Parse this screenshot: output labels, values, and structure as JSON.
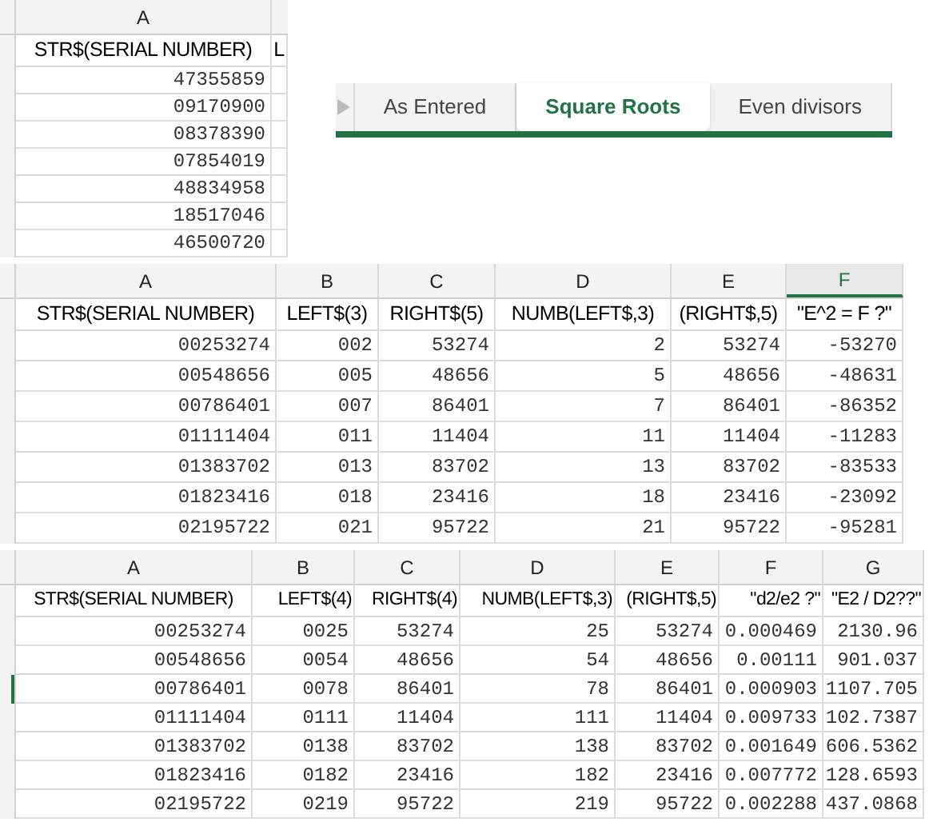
{
  "sheets": [
    {
      "columns": [
        {
          "letter": "A",
          "selected": false
        }
      ],
      "header": [
        "STR$(SERIAL NUMBER)",
        "L"
      ],
      "rows": [
        {
          "cells": [
            "47355859"
          ],
          "selected": false
        },
        {
          "cells": [
            "09170900"
          ],
          "selected": false
        },
        {
          "cells": [
            "08378390"
          ],
          "selected": false
        },
        {
          "cells": [
            "07854019"
          ],
          "selected": false
        },
        {
          "cells": [
            "48834958"
          ],
          "selected": false
        },
        {
          "cells": [
            "18517046"
          ],
          "selected": false
        },
        {
          "cells": [
            "46500720"
          ],
          "selected": false
        }
      ]
    },
    {
      "columns": [
        {
          "letter": "A",
          "selected": false
        },
        {
          "letter": "B",
          "selected": false
        },
        {
          "letter": "C",
          "selected": false
        },
        {
          "letter": "D",
          "selected": false
        },
        {
          "letter": "E",
          "selected": false
        },
        {
          "letter": "F",
          "selected": true
        }
      ],
      "header": [
        "STR$(SERIAL NUMBER)",
        "LEFT$(3)",
        "RIGHT$(5)",
        "NUMB(LEFT$,3)",
        "(RIGHT$,5)",
        "\"E^2 = F ?\""
      ],
      "rows": [
        {
          "cells": [
            "00253274",
            "002",
            "53274",
            "2",
            "53274",
            "-53270"
          ],
          "selected": false
        },
        {
          "cells": [
            "00548656",
            "005",
            "48656",
            "5",
            "48656",
            "-48631"
          ],
          "selected": false
        },
        {
          "cells": [
            "00786401",
            "007",
            "86401",
            "7",
            "86401",
            "-86352"
          ],
          "selected": false
        },
        {
          "cells": [
            "01111404",
            "011",
            "11404",
            "11",
            "11404",
            "-11283"
          ],
          "selected": false
        },
        {
          "cells": [
            "01383702",
            "013",
            "83702",
            "13",
            "83702",
            "-83533"
          ],
          "selected": false
        },
        {
          "cells": [
            "01823416",
            "018",
            "23416",
            "18",
            "23416",
            "-23092"
          ],
          "selected": false
        },
        {
          "cells": [
            "02195722",
            "021",
            "95722",
            "21",
            "95722",
            "-95281"
          ],
          "selected": false
        }
      ]
    },
    {
      "columns": [
        {
          "letter": "A",
          "selected": false
        },
        {
          "letter": "B",
          "selected": false
        },
        {
          "letter": "C",
          "selected": false
        },
        {
          "letter": "D",
          "selected": false
        },
        {
          "letter": "E",
          "selected": false
        },
        {
          "letter": "F",
          "selected": false
        },
        {
          "letter": "G",
          "selected": false
        }
      ],
      "header": [
        "STR$(SERIAL NUMBER)",
        "LEFT$(4)",
        "RIGHT$(4)",
        "NUMB(LEFT$,3)",
        "(RIGHT$,5)",
        "\"d2/e2 ?\"",
        "\"E2 / D2??\""
      ],
      "rows": [
        {
          "cells": [
            "00253274",
            "0025",
            "53274",
            "25",
            "53274",
            "0.000469",
            "2130.96"
          ],
          "selected": false
        },
        {
          "cells": [
            "00548656",
            "0054",
            "48656",
            "54",
            "48656",
            "0.00111",
            "901.037"
          ],
          "selected": false
        },
        {
          "cells": [
            "00786401",
            "0078",
            "86401",
            "78",
            "86401",
            "0.000903",
            "1107.705"
          ],
          "selected": true
        },
        {
          "cells": [
            "01111404",
            "0111",
            "11404",
            "111",
            "11404",
            "0.009733",
            "102.7387"
          ],
          "selected": false
        },
        {
          "cells": [
            "01383702",
            "0138",
            "83702",
            "138",
            "83702",
            "0.001649",
            "606.5362"
          ],
          "selected": false
        },
        {
          "cells": [
            "01823416",
            "0182",
            "23416",
            "182",
            "23416",
            "0.007772",
            "128.6593"
          ],
          "selected": false
        },
        {
          "cells": [
            "02195722",
            "0219",
            "95722",
            "219",
            "95722",
            "0.002288",
            "437.0868"
          ],
          "selected": false
        }
      ]
    }
  ],
  "sheet_tabs": [
    {
      "label": "As Entered",
      "selected": false
    },
    {
      "label": "Square Roots",
      "selected": true
    },
    {
      "label": "Even divisors",
      "selected": false
    }
  ]
}
